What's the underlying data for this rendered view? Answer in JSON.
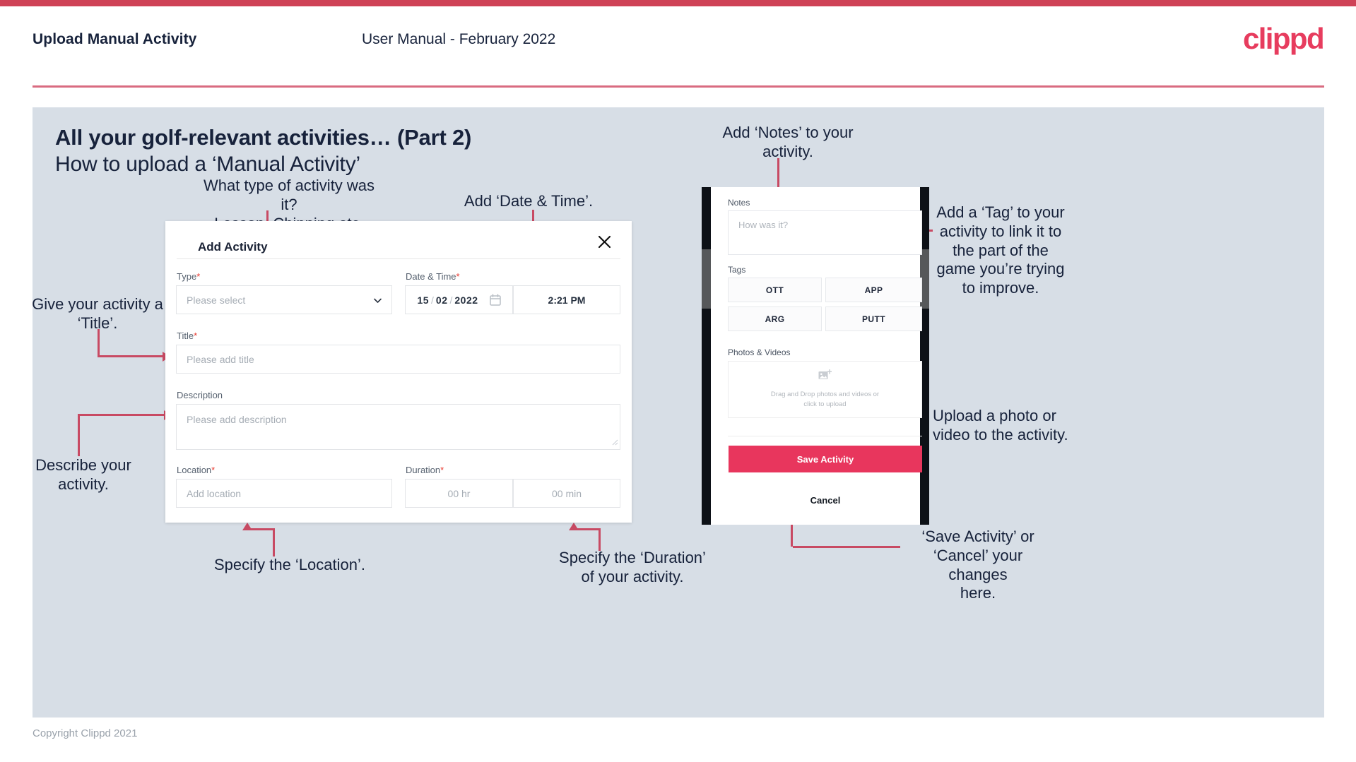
{
  "header": {
    "title": "Upload Manual Activity",
    "subtitle": "User Manual - February 2022",
    "logo": "clippd"
  },
  "slide": {
    "title_main": "All your golf-relevant activities… (Part 2)",
    "title_sub": "How to upload a ‘Manual Activity’"
  },
  "annotations": {
    "type": "What type of activity was it?\nLesson, Chipping etc.",
    "datetime": "Add ‘Date & Time’.",
    "title": "Give your activity a\n‘Title’.",
    "description": "Describe your\nactivity.",
    "location": "Specify the ‘Location’.",
    "duration": "Specify the ‘Duration’\nof your activity.",
    "notes": "Add ‘Notes’ to your\nactivity.",
    "tags": "Add a ‘Tag’ to your\nactivity to link it to\nthe part of the\ngame you’re trying\nto improve.",
    "upload": "Upload a photo or\nvideo to the activity.",
    "save_cancel": "‘Save Activity’ or\n‘Cancel’ your changes\nhere."
  },
  "dialog": {
    "title": "Add Activity",
    "close_icon": "close-icon",
    "fields": {
      "type": {
        "label": "Type",
        "required": "*",
        "placeholder": "Please select",
        "chevron": "chevron-down-icon"
      },
      "datetime": {
        "label": "Date & Time",
        "required": "*",
        "day": "15",
        "month": "02",
        "year": "2022",
        "sep": "/",
        "calendar_icon": "calendar-icon",
        "time": "2:21 PM"
      },
      "title": {
        "label": "Title",
        "required": "*",
        "placeholder": "Please add title"
      },
      "description": {
        "label": "Description",
        "required": "",
        "placeholder": "Please add description"
      },
      "location": {
        "label": "Location",
        "required": "*",
        "placeholder": "Add location"
      },
      "duration": {
        "label": "Duration",
        "required": "*",
        "hours": "00 hr",
        "minutes": "00 min"
      }
    }
  },
  "phone": {
    "notes": {
      "label": "Notes",
      "placeholder": "How was it?"
    },
    "tags": {
      "label": "Tags",
      "items": [
        "OTT",
        "APP",
        "ARG",
        "PUTT"
      ]
    },
    "photos": {
      "label": "Photos & Videos",
      "icon": "add-image-icon",
      "line1": "Drag and Drop photos and videos or",
      "line2": "click to upload"
    },
    "save_label": "Save Activity",
    "cancel_label": "Cancel"
  },
  "footer": {
    "copyright": "Copyright Clippd 2021"
  },
  "colors": {
    "accent": "#e8365d",
    "accent_bar": "#cf4257",
    "connector": "#c84a63",
    "slide_bg": "#d7dee6",
    "text": "#17223b"
  }
}
